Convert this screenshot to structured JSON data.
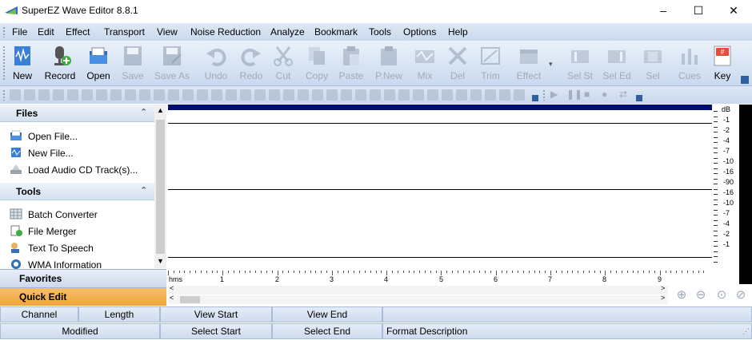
{
  "window": {
    "title": "SuperEZ Wave Editor 8.8.1",
    "minimize": "–",
    "maximize": "☐",
    "close": "✕"
  },
  "menu": [
    "File",
    "Edit",
    "Effect",
    "Transport",
    "View",
    "Noise Reduction",
    "Analyze",
    "Bookmark",
    "Tools",
    "Options",
    "Help"
  ],
  "toolbar": [
    {
      "label": "New",
      "enabled": true,
      "icon": "new-icon"
    },
    {
      "label": "Record",
      "enabled": true,
      "icon": "record-microphone-icon"
    },
    {
      "label": "Open",
      "enabled": true,
      "icon": "open-folder-icon"
    },
    {
      "label": "Save",
      "enabled": false,
      "icon": "save-icon"
    },
    {
      "label": "Save As",
      "enabled": false,
      "icon": "save-as-icon"
    },
    {
      "label": "Undo",
      "enabled": false,
      "icon": "undo-icon"
    },
    {
      "label": "Redo",
      "enabled": false,
      "icon": "redo-icon"
    },
    {
      "label": "Cut",
      "enabled": false,
      "icon": "cut-icon"
    },
    {
      "label": "Copy",
      "enabled": false,
      "icon": "copy-icon"
    },
    {
      "label": "Paste",
      "enabled": false,
      "icon": "paste-icon"
    },
    {
      "label": "P.New",
      "enabled": false,
      "icon": "paste-new-icon"
    },
    {
      "label": "Mix",
      "enabled": false,
      "icon": "mix-icon"
    },
    {
      "label": "Del",
      "enabled": false,
      "icon": "delete-icon"
    },
    {
      "label": "Trim",
      "enabled": false,
      "icon": "trim-icon"
    },
    {
      "label": "Effect",
      "enabled": false,
      "icon": "effect-icon"
    },
    {
      "label": "Sel St",
      "enabled": false,
      "icon": "select-start-icon"
    },
    {
      "label": "Sel Ed",
      "enabled": false,
      "icon": "select-end-icon"
    },
    {
      "label": "Sel",
      "enabled": false,
      "icon": "select-icon"
    },
    {
      "label": "Cues",
      "enabled": false,
      "icon": "cues-icon"
    },
    {
      "label": "Key",
      "enabled": true,
      "icon": "key-icon"
    }
  ],
  "files_section": {
    "title": "Files",
    "items": [
      "Open File...",
      "New File...",
      "Load Audio CD Track(s)..."
    ]
  },
  "tools_section": {
    "title": "Tools",
    "items": [
      "Batch Converter",
      "File Merger",
      "Text To Speech",
      "WMA Information"
    ]
  },
  "nav": {
    "favorites": "Favorites",
    "quick_edit": "Quick Edit"
  },
  "ruler": {
    "unit": "hms",
    "labels": [
      "1",
      "2",
      "3",
      "4",
      "5",
      "6",
      "7",
      "8",
      "9"
    ]
  },
  "db_scale": [
    "dB",
    "-1",
    "-2",
    "-4",
    "-7",
    "-10",
    "-16",
    "-90",
    "-16",
    "-10",
    "-7",
    "-4",
    "-2",
    "-1"
  ],
  "status": {
    "row1": [
      "Channel",
      "Length",
      "View Start",
      "View End",
      ""
    ],
    "row2": [
      "Modified",
      "Select Start",
      "Select End",
      "Format Description",
      ""
    ]
  },
  "colors": {
    "wave_header": "#000e6f",
    "quick_edit_bg": "#f2a93b",
    "toolbar_bg": "#c9d9ee"
  }
}
